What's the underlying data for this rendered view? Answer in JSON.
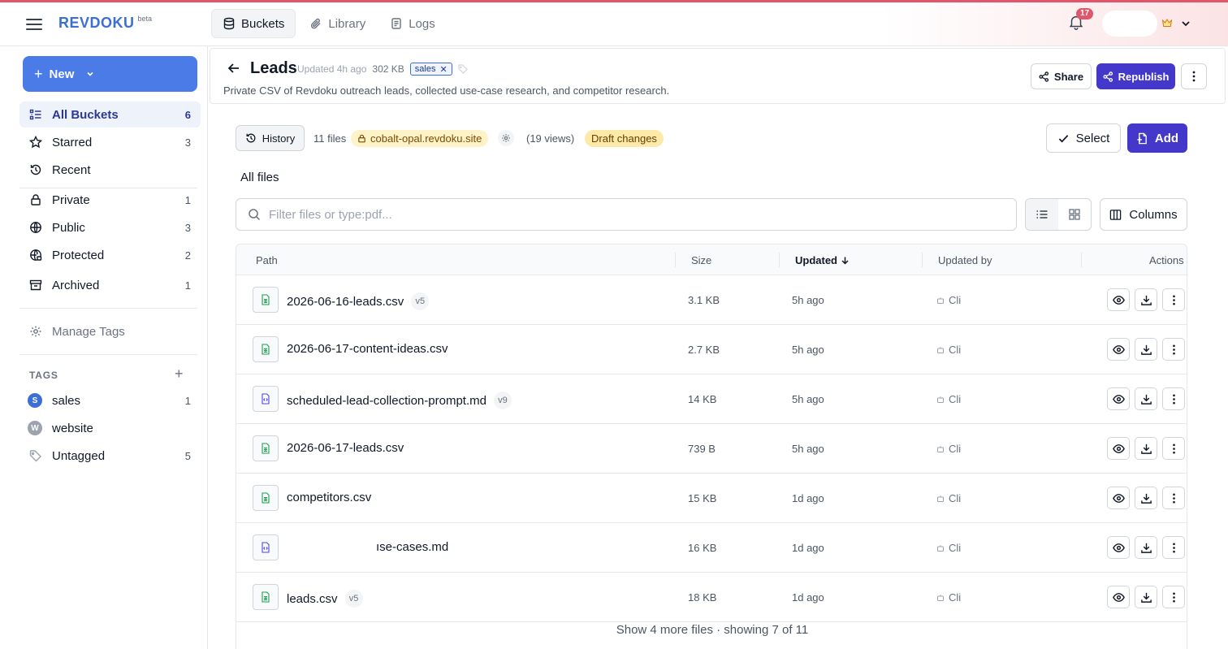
{
  "app": {
    "brand": "REVDOKU",
    "brand_suffix": "beta",
    "notification_count": "17",
    "accent_color": "#4338ca",
    "brand_color": "#3b6fd6"
  },
  "nav": {
    "tabs": [
      {
        "label": "Buckets",
        "icon": "database-icon",
        "active": true
      },
      {
        "label": "Library",
        "icon": "paperclip-icon",
        "active": false
      },
      {
        "label": "Logs",
        "icon": "logs-icon",
        "active": false
      }
    ]
  },
  "sidebar": {
    "new_label": "New",
    "items": [
      {
        "label": "All Buckets",
        "count": "6",
        "icon": "list-icon"
      },
      {
        "label": "Starred",
        "count": "3",
        "icon": "star-icon"
      },
      {
        "label": "Recent",
        "count": "",
        "icon": "history-icon"
      },
      {
        "label": "Private",
        "count": "1",
        "icon": "lock-icon"
      },
      {
        "label": "Public",
        "count": "3",
        "icon": "globe-icon"
      },
      {
        "label": "Protected",
        "count": "2",
        "icon": "globe-lock-icon"
      },
      {
        "label": "Archived",
        "count": "1",
        "icon": "archive-icon"
      }
    ],
    "manage_tags": "Manage Tags",
    "tags_heading": "TAGS",
    "tags": [
      {
        "label": "sales",
        "count": "1",
        "initial": "S",
        "color": "#3b6fd6"
      },
      {
        "label": "website",
        "count": "",
        "initial": "W",
        "color": "#9ca3af"
      },
      {
        "label": "Untagged",
        "count": "5",
        "initial": "",
        "color": ""
      }
    ]
  },
  "bucket": {
    "title": "Leads",
    "updated": "Updated 4h ago",
    "size": "302 KB",
    "tag": "sales",
    "description": "Private CSV of Revdoku outreach leads, collected use-case research, and competitor research.",
    "share_label": "Share",
    "republish_label": "Republish"
  },
  "toolbar": {
    "history_label": "History",
    "file_count": "11 files",
    "site": "cobalt-opal.revdoku.site",
    "views": "(19 views)",
    "draft": "Draft changes",
    "select_label": "Select",
    "add_label": "Add",
    "section_title": "All files",
    "filter_placeholder": "Filter files or type:pdf...",
    "columns_label": "Columns"
  },
  "table": {
    "headers": {
      "path": "Path",
      "size": "Size",
      "updated": "Updated",
      "updated_by": "Updated by",
      "actions": "Actions"
    },
    "rows": [
      {
        "name": "2026-06-16-leads.csv",
        "version": "v5",
        "size": "3.1 KB",
        "updated": "5h ago",
        "by": "Cli",
        "type": "csv"
      },
      {
        "name": "2026-06-17-content-ideas.csv",
        "version": "",
        "size": "2.7 KB",
        "updated": "5h ago",
        "by": "Cli",
        "type": "csv"
      },
      {
        "name": "scheduled-lead-collection-prompt.md",
        "version": "v9",
        "size": "14 KB",
        "updated": "5h ago",
        "by": "Cli",
        "type": "md"
      },
      {
        "name": "2026-06-17-leads.csv",
        "version": "",
        "size": "739 B",
        "updated": "5h ago",
        "by": "Cli",
        "type": "csv"
      },
      {
        "name": "competitors.csv",
        "version": "",
        "size": "15 KB",
        "updated": "1d ago",
        "by": "Cli",
        "type": "csv"
      },
      {
        "name": "ıse-cases.md",
        "version": "",
        "size": "16 KB",
        "updated": "1d ago",
        "by": "Cli",
        "type": "md"
      },
      {
        "name": "leads.csv",
        "version": "v5",
        "size": "18 KB",
        "updated": "1d ago",
        "by": "Cli",
        "type": "csv"
      }
    ],
    "show_more": "Show 4 more files · showing 7 of 11"
  }
}
